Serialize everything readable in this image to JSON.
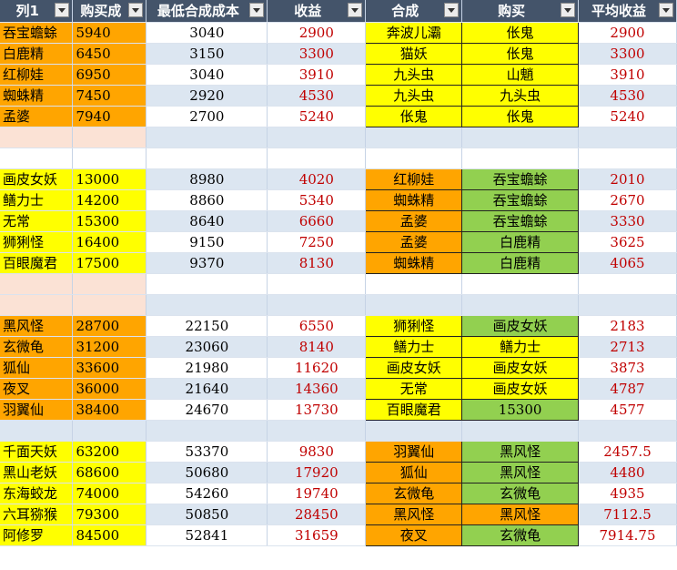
{
  "headers": [
    "列1",
    "购买成",
    "最低合成成本",
    "收益",
    "合成",
    "购买",
    "平均收益"
  ],
  "colors": {
    "header_bg": "#44546a",
    "orange": "#ffa500",
    "yellow": "#ffff00",
    "green": "#92d050",
    "value_red": "#c00000",
    "band": "#dce6f1",
    "separator": "#fbe2d5"
  },
  "rows": [
    {
      "kind": "data",
      "name": "吞宝蟾蜍",
      "buy": "5940",
      "cost": "3040",
      "profit": "2900",
      "craft": "奔波儿灞",
      "purchase": "伥鬼",
      "avg": "2900",
      "name_bg": "orange",
      "craft_bg": "yellow",
      "purchase_bg": "yellow"
    },
    {
      "kind": "data",
      "name": "白鹿精",
      "buy": "6450",
      "cost": "3150",
      "profit": "3300",
      "craft": "猫妖",
      "purchase": "伥鬼",
      "avg": "3300",
      "name_bg": "orange",
      "craft_bg": "yellow",
      "purchase_bg": "yellow"
    },
    {
      "kind": "data",
      "name": "红柳娃",
      "buy": "6950",
      "cost": "3040",
      "profit": "3910",
      "craft": "九头虫",
      "purchase": "山魈",
      "avg": "3910",
      "name_bg": "orange",
      "craft_bg": "yellow",
      "purchase_bg": "yellow"
    },
    {
      "kind": "data",
      "name": "蜘蛛精",
      "buy": "7450",
      "cost": "2920",
      "profit": "4530",
      "craft": "九头虫",
      "purchase": "九头虫",
      "avg": "4530",
      "name_bg": "orange",
      "craft_bg": "yellow",
      "purchase_bg": "yellow"
    },
    {
      "kind": "data",
      "name": "孟婆",
      "buy": "7940",
      "cost": "2700",
      "profit": "5240",
      "craft": "伥鬼",
      "purchase": "伥鬼",
      "avg": "5240",
      "name_bg": "orange",
      "craft_bg": "yellow",
      "purchase_bg": "yellow"
    },
    {
      "kind": "sep",
      "peach": true
    },
    {
      "kind": "sep",
      "peach": false
    },
    {
      "kind": "data",
      "name": "画皮女妖",
      "buy": "13000",
      "cost": "8980",
      "profit": "4020",
      "craft": "红柳娃",
      "purchase": "吞宝蟾蜍",
      "avg": "2010",
      "name_bg": "yellow",
      "craft_bg": "orange",
      "purchase_bg": "green"
    },
    {
      "kind": "data",
      "name": "鳝力士",
      "buy": "14200",
      "cost": "8860",
      "profit": "5340",
      "craft": "蜘蛛精",
      "purchase": "吞宝蟾蜍",
      "avg": "2670",
      "name_bg": "yellow",
      "craft_bg": "orange",
      "purchase_bg": "green"
    },
    {
      "kind": "data",
      "name": "无常",
      "buy": "15300",
      "cost": "8640",
      "profit": "6660",
      "craft": "孟婆",
      "purchase": "吞宝蟾蜍",
      "avg": "3330",
      "name_bg": "yellow",
      "craft_bg": "orange",
      "purchase_bg": "green"
    },
    {
      "kind": "data",
      "name": "狮猁怪",
      "buy": "16400",
      "cost": "9150",
      "profit": "7250",
      "craft": "孟婆",
      "purchase": "白鹿精",
      "avg": "3625",
      "name_bg": "yellow",
      "craft_bg": "orange",
      "purchase_bg": "green"
    },
    {
      "kind": "data",
      "name": "百眼魔君",
      "buy": "17500",
      "cost": "9370",
      "profit": "8130",
      "craft": "蜘蛛精",
      "purchase": "白鹿精",
      "avg": "4065",
      "name_bg": "yellow",
      "craft_bg": "orange",
      "purchase_bg": "green"
    },
    {
      "kind": "sep",
      "peach": true
    },
    {
      "kind": "sep",
      "peach": true
    },
    {
      "kind": "data",
      "name": "黑风怪",
      "buy": "28700",
      "cost": "22150",
      "profit": "6550",
      "craft": "狮猁怪",
      "purchase": "画皮女妖",
      "avg": "2183",
      "name_bg": "orange",
      "craft_bg": "yellow",
      "purchase_bg": "green"
    },
    {
      "kind": "data",
      "name": "玄微龟",
      "buy": "31200",
      "cost": "23060",
      "profit": "8140",
      "craft": "鳝力士",
      "purchase": "鳝力士",
      "avg": "2713",
      "name_bg": "orange",
      "craft_bg": "yellow",
      "purchase_bg": "yellow"
    },
    {
      "kind": "data",
      "name": "狐仙",
      "buy": "33600",
      "cost": "21980",
      "profit": "11620",
      "craft": "画皮女妖",
      "purchase": "画皮女妖",
      "avg": "3873",
      "name_bg": "orange",
      "craft_bg": "yellow",
      "purchase_bg": "yellow"
    },
    {
      "kind": "data",
      "name": "夜叉",
      "buy": "36000",
      "cost": "21640",
      "profit": "14360",
      "craft": "无常",
      "purchase": "画皮女妖",
      "avg": "4787",
      "name_bg": "orange",
      "craft_bg": "yellow",
      "purchase_bg": "yellow"
    },
    {
      "kind": "data",
      "name": "羽翼仙",
      "buy": "38400",
      "cost": "24670",
      "profit": "13730",
      "craft": "百眼魔君",
      "purchase": "15300",
      "avg": "4577",
      "name_bg": "orange",
      "craft_bg": "yellow",
      "purchase_bg": "green"
    },
    {
      "kind": "sep",
      "peach": false
    },
    {
      "kind": "data",
      "name": "千面天妖",
      "buy": "63200",
      "cost": "53370",
      "profit": "9830",
      "craft": "羽翼仙",
      "purchase": "黑风怪",
      "avg": "2457.5",
      "name_bg": "yellow",
      "craft_bg": "orange",
      "purchase_bg": "green"
    },
    {
      "kind": "data",
      "name": "黑山老妖",
      "buy": "68600",
      "cost": "50680",
      "profit": "17920",
      "craft": "狐仙",
      "purchase": "黑风怪",
      "avg": "4480",
      "name_bg": "yellow",
      "craft_bg": "orange",
      "purchase_bg": "green"
    },
    {
      "kind": "data",
      "name": "东海蛟龙",
      "buy": "74000",
      "cost": "54260",
      "profit": "19740",
      "craft": "玄微龟",
      "purchase": "玄微龟",
      "avg": "4935",
      "name_bg": "yellow",
      "craft_bg": "orange",
      "purchase_bg": "green"
    },
    {
      "kind": "data",
      "name": "六耳猕猴",
      "buy": "79300",
      "cost": "50850",
      "profit": "28450",
      "craft": "黑风怪",
      "purchase": "黑风怪",
      "avg": "7112.5",
      "name_bg": "yellow",
      "craft_bg": "orange",
      "purchase_bg": "orange"
    },
    {
      "kind": "data",
      "name": "阿修罗",
      "buy": "84500",
      "cost": "52841",
      "profit": "31659",
      "craft": "夜叉",
      "purchase": "玄微龟",
      "avg": "7914.75",
      "name_bg": "yellow",
      "craft_bg": "orange",
      "purchase_bg": "green"
    }
  ]
}
